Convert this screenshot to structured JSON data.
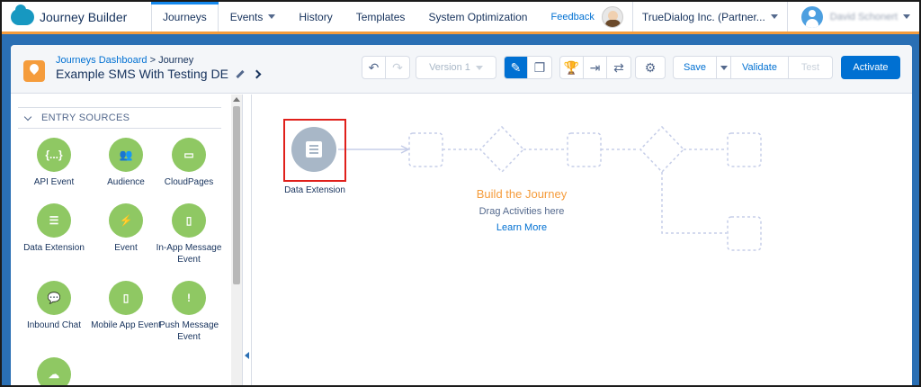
{
  "app": {
    "brand": "Journey Builder",
    "icon": "salesforce-cloud-icon"
  },
  "nav": {
    "tabs": [
      {
        "label": "Journeys",
        "active": true
      },
      {
        "label": "Events",
        "dropdown": true
      },
      {
        "label": "History"
      },
      {
        "label": "Templates"
      },
      {
        "label": "System Optimization"
      }
    ],
    "feedback": "Feedback",
    "org": "TrueDialog Inc. (Partner...",
    "user": "David Schonert"
  },
  "header": {
    "breadcrumb_link": "Journeys Dashboard",
    "breadcrumb_sep": " > ",
    "breadcrumb_current": "Journey",
    "journey_name": "Example SMS With Testing DE",
    "version": "Version 1",
    "save": "Save",
    "validate": "Validate",
    "test": "Test",
    "activate": "Activate"
  },
  "sidebar": {
    "section": "ENTRY SOURCES",
    "tiles": [
      {
        "label": "API Event",
        "glyph": "{...}",
        "icon": "api-event-icon"
      },
      {
        "label": "Audience",
        "glyph": "👥",
        "icon": "audience-icon"
      },
      {
        "label": "CloudPages",
        "glyph": "▭",
        "icon": "cloudpages-icon"
      },
      {
        "label": "Data Extension",
        "glyph": "☰",
        "icon": "data-extension-icon"
      },
      {
        "label": "Event",
        "glyph": "⚡",
        "icon": "event-icon"
      },
      {
        "label": "In-App Message Event",
        "glyph": "▯",
        "icon": "in-app-message-icon"
      },
      {
        "label": "Inbound Chat",
        "glyph": "💬",
        "icon": "inbound-chat-icon"
      },
      {
        "label": "Mobile App Event",
        "glyph": "▯",
        "icon": "mobile-app-icon"
      },
      {
        "label": "Push Message Event",
        "glyph": "!",
        "icon": "push-message-icon"
      },
      {
        "label": "",
        "glyph": "☁",
        "icon": "cloud-icon"
      }
    ]
  },
  "canvas": {
    "entry_label": "Data Extension",
    "build_title": "Build the Journey",
    "build_sub": "Drag Activities here",
    "learn_more": "Learn More"
  },
  "colors": {
    "accent": "#0070d2",
    "band": "#2a6fb4",
    "tile": "#8fc863",
    "orange": "#f59c3c",
    "highlight": "#e0201b"
  }
}
